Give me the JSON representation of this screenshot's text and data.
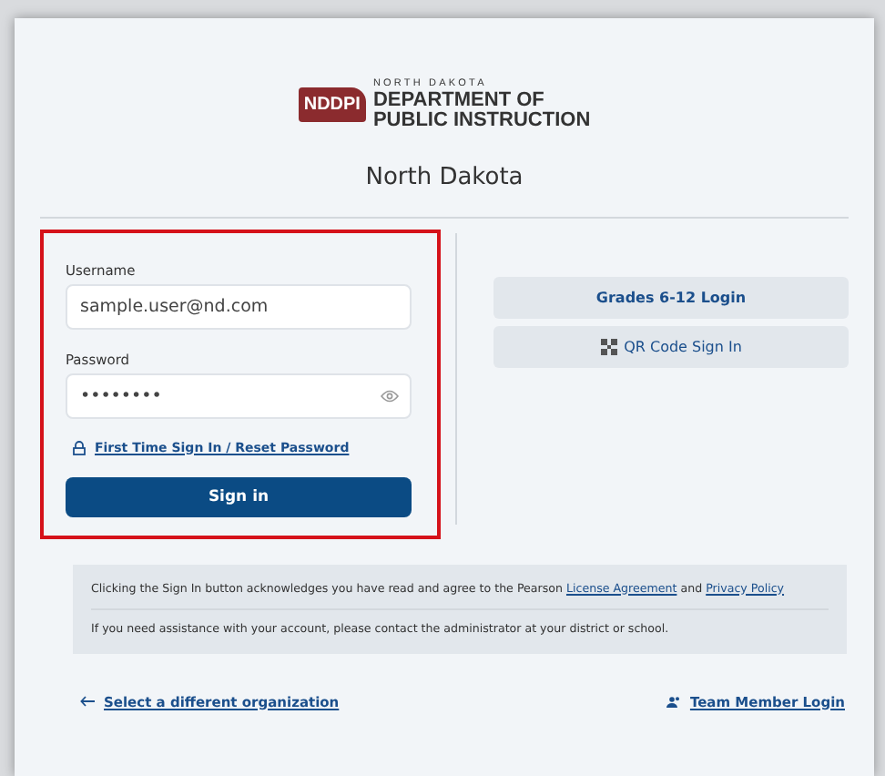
{
  "logo": {
    "badge": "NDDPI",
    "state_line": "NORTH DAKOTA",
    "name_line_1": "DEPARTMENT OF",
    "name_line_2": "PUBLIC INSTRUCTION"
  },
  "title": "North Dakota",
  "login_form": {
    "highlighted": true,
    "username": {
      "label": "Username",
      "value": "sample.user@nd.com"
    },
    "password": {
      "label": "Password",
      "value": "••••••••"
    },
    "reset_link": "First Time Sign In / Reset Password",
    "sign_in_button": "Sign in"
  },
  "alt_logins": [
    "Grades 6-12 Login",
    "QR Code Sign In"
  ],
  "notice": {
    "consent": {
      "text_before": "Clicking the Sign In button acknowledges you have read and agree to the Pearson",
      "link_1": "License Agreement",
      "text_middle": "and",
      "link_2": "Privacy Policy"
    },
    "assistance": "If you need assistance with your account, please contact the administrator at your district or school."
  },
  "footer": {
    "back_link": "Select a different organization",
    "team_link": "Team Member Login"
  }
}
